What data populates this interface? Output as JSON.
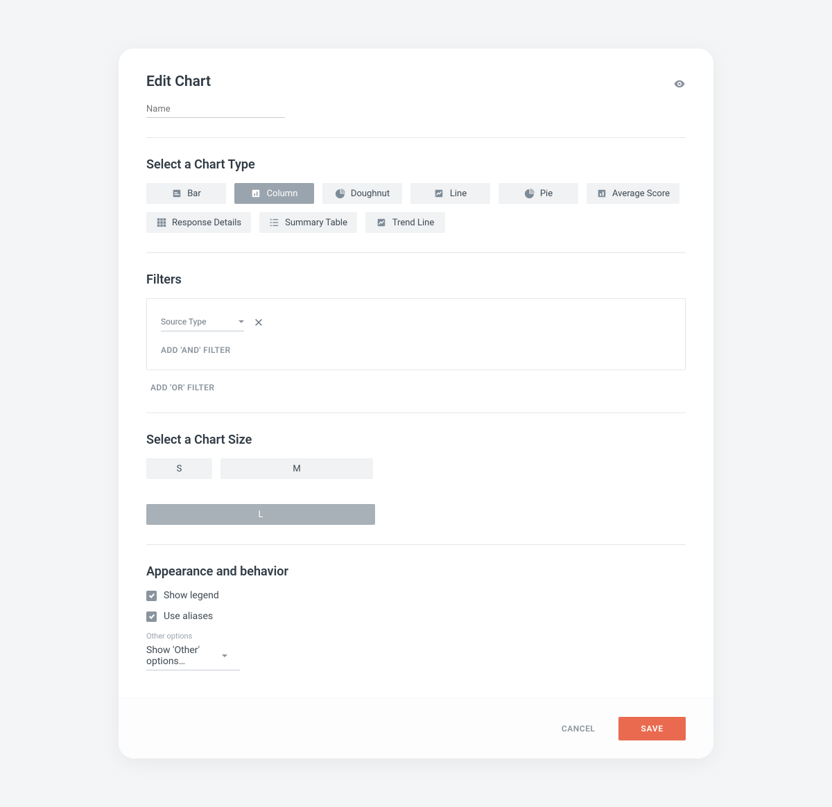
{
  "header": {
    "title": "Edit Chart",
    "name_placeholder": "Name"
  },
  "chart_type": {
    "heading": "Select a Chart Type",
    "options": {
      "bar": "Bar",
      "column": "Column",
      "doughnut": "Doughnut",
      "line": "Line",
      "pie": "Pie",
      "average_score": "Average Score",
      "response_details": "Response Details",
      "summary_table": "Summary Table",
      "trend_line": "Trend Line"
    },
    "selected": "column"
  },
  "filters": {
    "heading": "Filters",
    "source_type_label": "Source Type",
    "add_and": "ADD 'AND' FILTER",
    "add_or": "ADD 'OR' FILTER"
  },
  "size": {
    "heading": "Select a Chart Size",
    "s": "S",
    "m": "M",
    "l": "L",
    "selected": "l"
  },
  "appearance": {
    "heading": "Appearance and behavior",
    "show_legend": "Show legend",
    "use_aliases": "Use aliases",
    "other_options_label": "Other options",
    "other_options_value": "Show 'Other' options…"
  },
  "footer": {
    "cancel": "CANCEL",
    "save": "SAVE"
  }
}
